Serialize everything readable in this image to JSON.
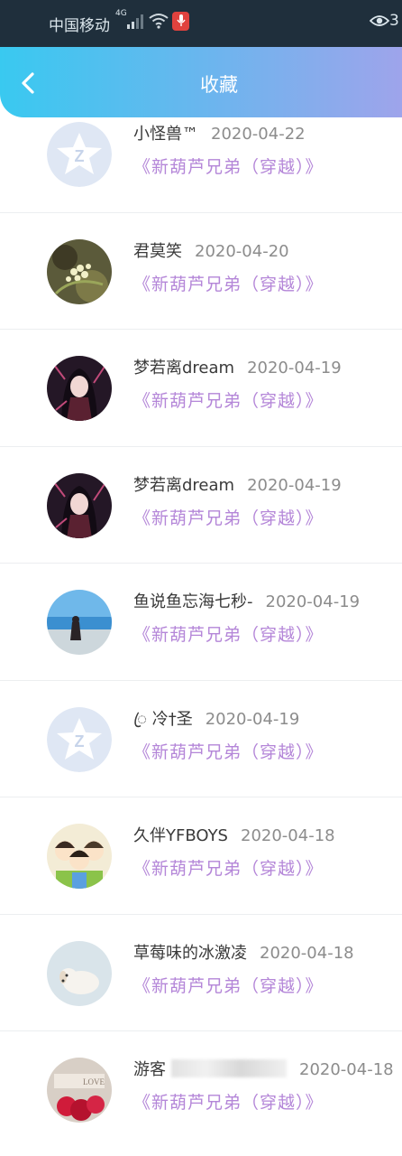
{
  "status_bar": {
    "carrier": "中国移动",
    "network": "4G",
    "right_number": "3"
  },
  "header": {
    "title": "收藏"
  },
  "colors": {
    "link": "#b486d8",
    "header_start": "#39c9f0",
    "header_end": "#9ea4eb"
  },
  "items": [
    {
      "name": "小怪兽™",
      "date": "2020-04-22",
      "link": "《新葫芦兄弟（穿越）》",
      "avatar": "default-qq-avatar-icon"
    },
    {
      "name": "君莫笑",
      "date": "2020-04-20",
      "link": "《新葫芦兄弟（穿越）》",
      "avatar": "flower-photo-avatar"
    },
    {
      "name": "梦若离dream",
      "date": "2020-04-19",
      "link": "《新葫芦兄弟（穿越）》",
      "avatar": "anime-girl-avatar"
    },
    {
      "name": "梦若离dream",
      "date": "2020-04-19",
      "link": "《新葫芦兄弟（穿越）》",
      "avatar": "anime-girl-avatar"
    },
    {
      "name": "鱼说鱼忘海七秒-",
      "date": "2020-04-19",
      "link": "《新葫芦兄弟（穿越）》",
      "avatar": "beach-photo-avatar"
    },
    {
      "name": "ꦿ 冷†圣",
      "date": "2020-04-19",
      "link": "《新葫芦兄弟（穿越）》",
      "avatar": "default-qq-avatar-icon"
    },
    {
      "name": "久伴YFBOYS",
      "date": "2020-04-18",
      "link": "《新葫芦兄弟（穿越）》",
      "avatar": "cartoon-boys-avatar"
    },
    {
      "name": "草莓味的冰激凌",
      "date": "2020-04-18",
      "link": "《新葫芦兄弟（穿越）》",
      "avatar": "puppy-photo-avatar"
    },
    {
      "name": "游客",
      "date": "2020-04-18",
      "link": "《新葫芦兄弟（穿越）》",
      "avatar": "rose-photo-avatar"
    }
  ]
}
